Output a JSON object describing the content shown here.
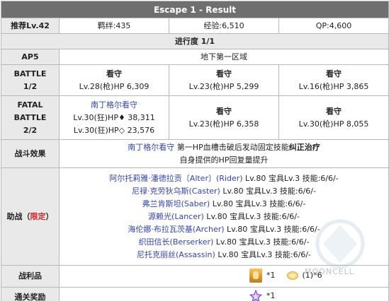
{
  "title": "Escape 1 - Result",
  "info": {
    "recommend": "推荐Lv.42",
    "bond": "羁绊:435",
    "exp": "经验:6,510",
    "qp": "QP:4,600"
  },
  "progress_label": "进行度 1/1",
  "ap": {
    "label": "AP5",
    "location": "地下第一区域"
  },
  "battle1": {
    "label_line1": "BATTLE",
    "label_line2": "1/2",
    "enemies": [
      {
        "name": "看守",
        "stats": "Lv.28(枪)HP 6,309"
      },
      {
        "name": "看守",
        "stats": "Lv.23(枪)HP 5,299"
      },
      {
        "name": "看守",
        "stats": "Lv.16(枪)HP 3,865"
      }
    ]
  },
  "battle2": {
    "label_line1": "FATAL",
    "label_line2": "BATTLE",
    "label_line3": "2/2",
    "boss_name": "南丁格尔看守",
    "boss_stats1": "Lv.30(狂)HP♦ 38,311",
    "boss_stats2": "Lv.30(狂)HP◇ 23,576",
    "enemies": [
      {
        "name": "看守",
        "stats": "Lv.23(枪)HP 6,358"
      },
      {
        "name": "看守",
        "stats": "Lv.30(枪)HP 8,055"
      }
    ]
  },
  "effect": {
    "label": "战斗效果",
    "target": "南丁格尔看守",
    "text1": " 第一HP血槽击破后发动固定技能",
    "bold": "纠正治疗",
    "text2": "自身提供的HP回复量提升"
  },
  "support": {
    "label": "助战（",
    "label_red": "限定",
    "label_end": "）",
    "servants": [
      {
        "name": "阿尔托莉雅·潘德拉贡〔Alter〕(Rider)",
        "info": " Lv.80 宝具Lv.3 技能:6/6/-"
      },
      {
        "name": "尼禄·克劳狄乌斯(Caster)",
        "info": " Lv.80 宝具Lv.3 技能:6/6/-"
      },
      {
        "name": "弗兰肯斯坦(Saber)",
        "info": " Lv.80 宝具Lv.3 技能:6/6/-"
      },
      {
        "name": "源赖光(Lancer)",
        "info": " Lv.80 宝具Lv.3 技能:6/6/-"
      },
      {
        "name": "海伦娜·布拉瓦茨基(Archer)",
        "info": " Lv.80 宝具Lv.3 技能:6/6/-"
      },
      {
        "name": "织田信长(Berserker)",
        "info": " Lv.80 宝具Lv.3 技能:6/6/-"
      },
      {
        "name": "尼托克丽丝(Assassin)",
        "info": " Lv.80 宝具Lv.3 技能:6/6/-"
      }
    ]
  },
  "drops": {
    "label": "战利品",
    "item1_count": "*1",
    "item2_text": "(1)*6"
  },
  "clear_reward": {
    "label": "通关奖励",
    "count": "*1"
  },
  "watermark": "MOONCELL",
  "icons": {
    "item1": "gold-item-icon",
    "item2": "coin-icon",
    "reward": "saint-quartz-icon"
  }
}
